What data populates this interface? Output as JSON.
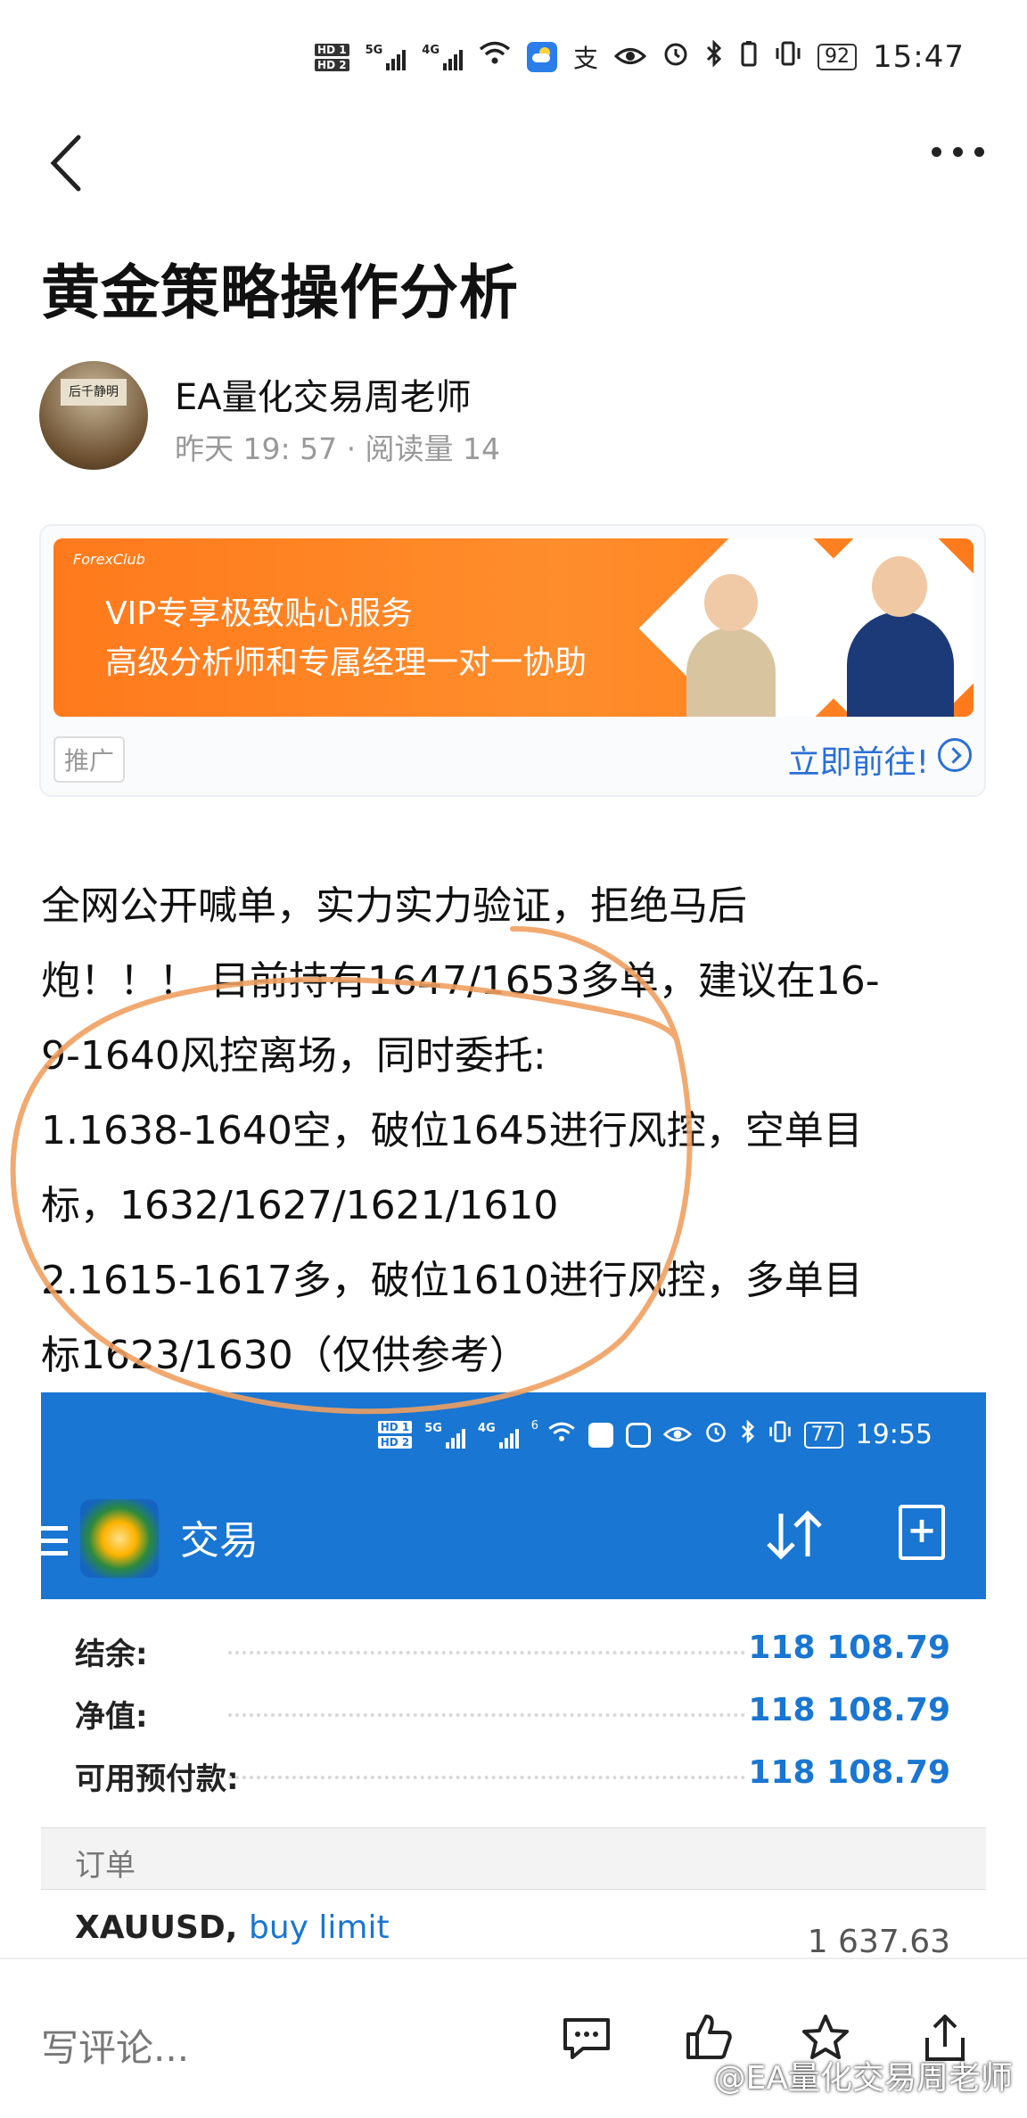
{
  "status_bar": {
    "hd1": "HD 1",
    "hd2": "HD 2",
    "net1": "5G",
    "net2": "4G",
    "battery": "92",
    "time": "15:47",
    "extra_glyph": "支"
  },
  "article": {
    "title": "黄金策略操作分析",
    "author_name": "EA量化交易周老师",
    "meta": "昨天 19: 57 · 阅读量 14",
    "avatar_sign": "后千静明"
  },
  "ad": {
    "logo": "ForexClub",
    "line1": "VIP专享极致贴心服务",
    "line2": "高级分析师和专属经理一对一协助",
    "tag": "推广",
    "cta": "立即前往!"
  },
  "post": {
    "lines": [
      "全网公开喊单，实力实力验证，拒绝马后",
      "炮！！！ 目前持有1647/1653多单，建议在16-",
      "9-1640风控离场，同时委托:",
      "1.1638-1640空，破位1645进行风控，空单目",
      "标，1632/1627/1621/1610",
      "2.1615-1617多，破位1610进行风控，多单目",
      "标1623/1630（仅供参考）"
    ]
  },
  "embedded": {
    "status_time": "19:55",
    "battery": "77",
    "hd1": "HD 1",
    "hd2": "HD 2",
    "net1": "5G",
    "net2": "4G",
    "net3": "6",
    "title": "交易",
    "rows": [
      {
        "label": "结余:",
        "value": "118 108.79"
      },
      {
        "label": "净值:",
        "value": "118 108.79"
      },
      {
        "label": "可用预付款:",
        "value": "118 108.79"
      }
    ],
    "section": "订单",
    "order_symbol": "XAUUSD,",
    "order_type": "buy limit",
    "order_price": "1 637.63"
  },
  "bottom": {
    "comment_placeholder": "写评论...",
    "watermark": "@EA量化交易周老师"
  },
  "colors": {
    "accent_blue": "#1976d2",
    "ad_orange": "#ff7a1c",
    "annotation_circle": "#f0a060"
  }
}
